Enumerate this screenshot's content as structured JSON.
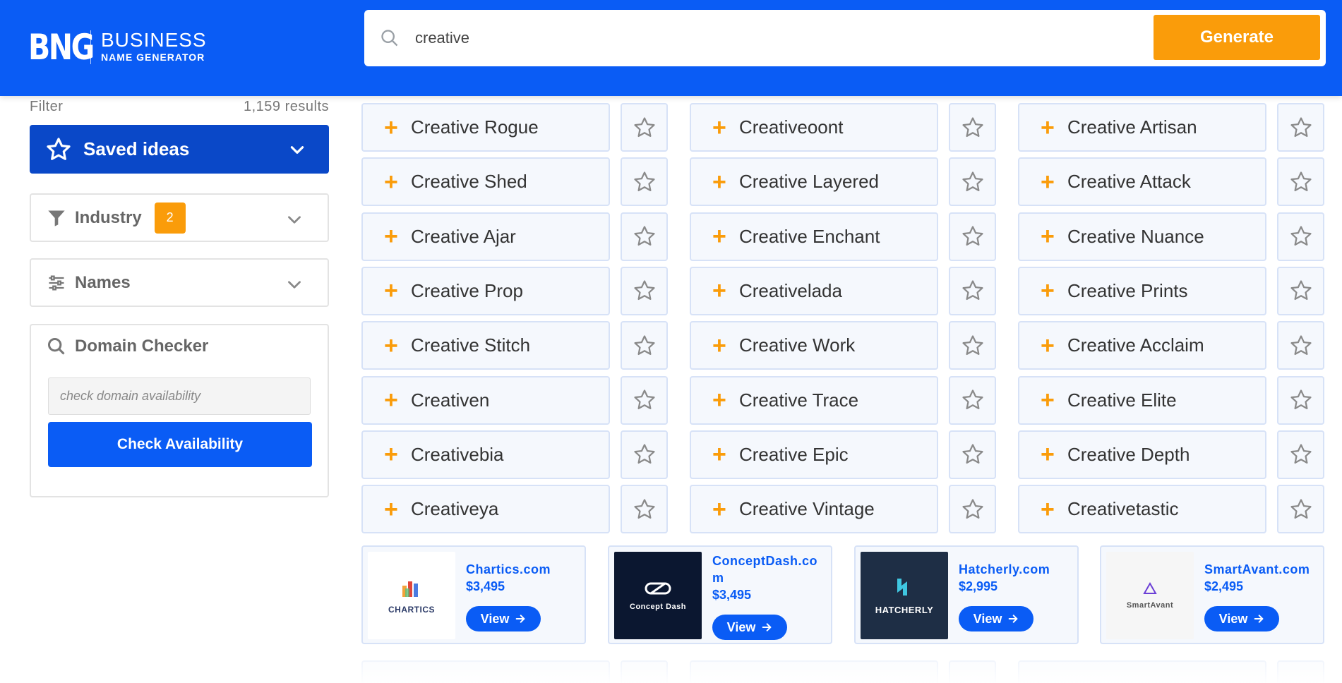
{
  "header": {
    "logo_mark": "BNG",
    "logo_line1": "BUSINESS",
    "logo_line2": "NAME GENERATOR",
    "search_value": "creative",
    "generate_label": "Generate"
  },
  "sidebar": {
    "filter_label": "Filter",
    "results_count": "1,159 results",
    "saved_ideas_label": "Saved ideas",
    "industry_label": "Industry",
    "industry_count": "2",
    "names_label": "Names",
    "domain_checker_label": "Domain Checker",
    "domain_placeholder": "check domain availability",
    "check_button_label": "Check Availability"
  },
  "names": [
    [
      "Creative Rogue",
      "Creative Shed",
      "Creative Ajar",
      "Creative Prop",
      "Creative Stitch",
      "Creativen",
      "Creativebia",
      "Creativeya"
    ],
    [
      "Creativeoont",
      "Creative Layered",
      "Creative Enchant",
      "Creativelada",
      "Creative Work",
      "Creative Trace",
      "Creative Epic",
      "Creative Vintage"
    ],
    [
      "Creative Artisan",
      "Creative Attack",
      "Creative Nuance",
      "Creative Prints",
      "Creative Acclaim",
      "Creative Elite",
      "Creative Depth",
      "Creativetastic"
    ]
  ],
  "plus_glyph": "+",
  "domain_ads": [
    {
      "name": "Chartics.com",
      "price": "$3,495",
      "logo_text": "CHARTICS",
      "view_label": "View"
    },
    {
      "name": "ConceptDash.com",
      "price": "$3,495",
      "logo_text": "Concept Dash",
      "view_label": "View"
    },
    {
      "name": "Hatcherly.com",
      "price": "$2,995",
      "logo_text": "HATCHERLY",
      "view_label": "View"
    },
    {
      "name": "SmartAvant.com",
      "price": "$2,495",
      "logo_text": "SmartAvant",
      "view_label": "View"
    }
  ],
  "colors": {
    "header_blue": "#0a5cf5",
    "saved_blue": "#0a48c8",
    "accent_orange": "#fa9c0a",
    "card_bg": "#f5f8fd",
    "card_border": "#d7e2f7"
  },
  "icons": {
    "search": "search-icon",
    "star": "star-icon",
    "filter": "filter-icon",
    "sliders": "sliders-icon",
    "chevron": "chevron-down-icon",
    "arrow": "arrow-right-icon"
  }
}
